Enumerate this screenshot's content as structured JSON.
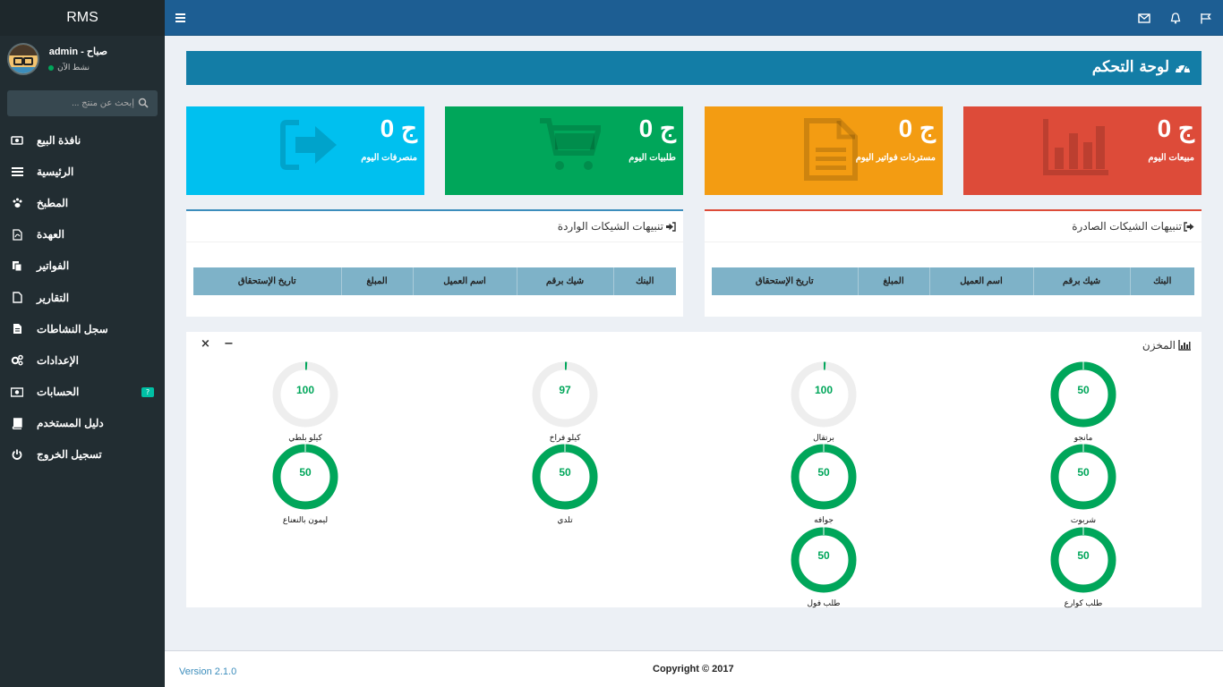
{
  "app": {
    "brand": "RMS",
    "version": "Version 2.1.0",
    "copyright": "Copyright © 2017"
  },
  "user": {
    "name": "admin - صباح",
    "status": "نشط الآن"
  },
  "search": {
    "placeholder": "إبحث عن منتج ..."
  },
  "sidebar": {
    "items": [
      {
        "label": "نافذة البيع",
        "icon": "cash-register-icon"
      },
      {
        "label": "الرئيسية",
        "icon": "list-icon"
      },
      {
        "label": "المطبخ",
        "icon": "paw-icon"
      },
      {
        "label": "العهدة",
        "icon": "pdf-file-icon"
      },
      {
        "label": "الفواتير",
        "icon": "copy-icon"
      },
      {
        "label": "التقارير",
        "icon": "file-icon"
      },
      {
        "label": "سجل النشاطات",
        "icon": "file-text-icon"
      },
      {
        "label": "الإعدادات",
        "icon": "cogs-icon"
      },
      {
        "label": "الحسابات",
        "icon": "money-icon",
        "badge": "?"
      },
      {
        "label": "دليل المستخدم",
        "icon": "book-icon"
      },
      {
        "label": "تسجيل الخروج",
        "icon": "power-icon"
      }
    ]
  },
  "page": {
    "title": "لوحة التحكم"
  },
  "tiles": [
    {
      "value": "0 ج",
      "label": "مبيعات اليوم",
      "color": "#dd4b39",
      "icon": "bar-chart-icon"
    },
    {
      "value": "0 ج",
      "label": "مستردات فواتير اليوم",
      "color": "#f39c12",
      "icon": "document-icon"
    },
    {
      "value": "0 ج",
      "label": "طلبيات اليوم",
      "color": "#00a65a",
      "icon": "cart-icon"
    },
    {
      "value": "0 ج",
      "label": "منصرفات اليوم",
      "color": "#00c0ef",
      "icon": "sign-out-icon"
    }
  ],
  "cheques_out": {
    "title": "تنبيهات الشيكات الصادرة",
    "columns": [
      "البنك",
      "شيك برقم",
      "اسم العميل",
      "المبلغ",
      "تاريخ الإستحقاق"
    ]
  },
  "cheques_in": {
    "title": "تنبيهات الشيكات الواردة",
    "columns": [
      "البنك",
      "شيك برقم",
      "اسم العميل",
      "المبلغ",
      "تاريخ الإستحقاق"
    ]
  },
  "stock": {
    "title": "المخزن",
    "minimize": "−",
    "close": "×",
    "items": [
      {
        "name": "مانجو",
        "value": 50,
        "percent": 100
      },
      {
        "name": "برتقال",
        "value": 100,
        "percent": 1
      },
      {
        "name": "كيلو فراخ",
        "value": 97,
        "percent": 1
      },
      {
        "name": "كيلو بلطي",
        "value": 100,
        "percent": 1
      },
      {
        "name": "شربوت",
        "value": 50,
        "percent": 100
      },
      {
        "name": "جوافه",
        "value": 50,
        "percent": 100
      },
      {
        "name": "تلدي",
        "value": 50,
        "percent": 100
      },
      {
        "name": "ليمون بالنعناع",
        "value": 50,
        "percent": 100
      },
      {
        "name": "طلب كوارع",
        "value": 50,
        "percent": 100
      },
      {
        "name": "طلب فول",
        "value": 50,
        "percent": 100
      }
    ]
  },
  "colors": {
    "accent": "#00a65a",
    "header": "#1d5e93",
    "sidebar": "#222d32",
    "title_bar": "#137da6"
  }
}
